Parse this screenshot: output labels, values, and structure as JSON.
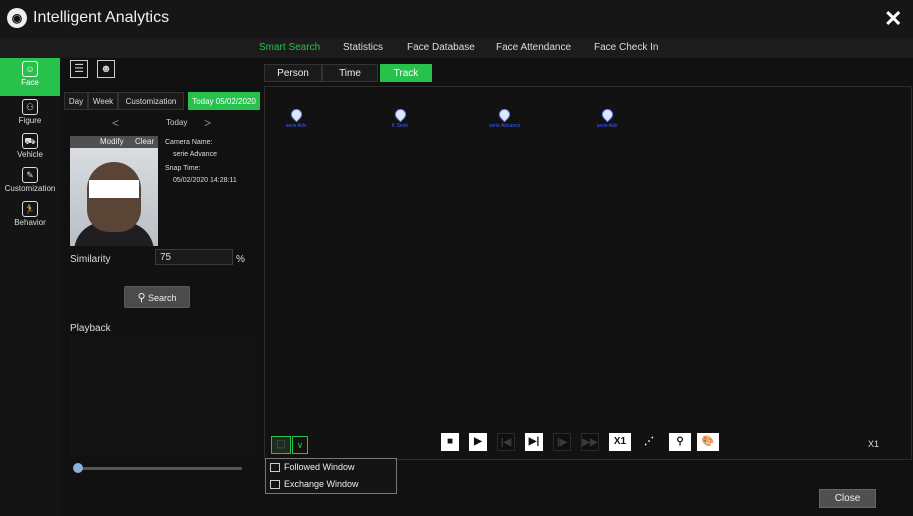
{
  "app": {
    "title": "Intelligent Analytics",
    "logo_icon": "camera-logo-icon",
    "close_glyph": "✕"
  },
  "top_tabs": [
    {
      "label": "Smart Search",
      "active": true
    },
    {
      "label": "Statistics"
    },
    {
      "label": "Face Database"
    },
    {
      "label": "Face Attendance"
    },
    {
      "label": "Face Check In"
    }
  ],
  "sidebar": [
    {
      "label": "Face",
      "icon": "face-scan-icon",
      "active": true
    },
    {
      "label": "Figure",
      "icon": "people-icon"
    },
    {
      "label": "Vehicle",
      "icon": "car-icon"
    },
    {
      "label": "Customization",
      "icon": "custom-icon"
    },
    {
      "label": "Behavior",
      "icon": "running-person-icon"
    }
  ],
  "search": {
    "ranges": [
      {
        "label": "Day"
      },
      {
        "label": "Week"
      },
      {
        "label": "Customization"
      },
      {
        "label": "Today 05/02/2020",
        "active": true
      }
    ],
    "nav": {
      "prev": "<",
      "label": "Today",
      "next": ">"
    },
    "face_card": {
      "modify": "Modify",
      "clear": "Clear"
    },
    "details": {
      "camera_label": "Camera Name:",
      "camera_value": "serie Advance",
      "snap_label": "Snap Time:",
      "snap_value": "05/02/2020 14:28:11"
    },
    "similarity_label": "Similarity",
    "similarity_value": "75",
    "similarity_unit": "%",
    "search_button": "Search",
    "playback_label": "Playback"
  },
  "mode_tabs": [
    {
      "label": "Person"
    },
    {
      "label": "Time"
    },
    {
      "label": "Track",
      "active": true
    }
  ],
  "track_pins": [
    {
      "label": "serie Adv"
    },
    {
      "label": "K Serie"
    },
    {
      "label": "serie Advance"
    },
    {
      "label": "serie Adv"
    }
  ],
  "controls": {
    "speed_button": "X1",
    "speed_status": "X1"
  },
  "window_menu": {
    "items": [
      {
        "label": "Followed Window",
        "icon": "followed-window-icon"
      },
      {
        "label": "Exchange Window",
        "icon": "exchange-window-icon"
      }
    ]
  },
  "footer": {
    "close_button": "Close"
  },
  "colors": {
    "accent": "#27c24c",
    "background": "#111111",
    "pin": "#3b5cff"
  }
}
